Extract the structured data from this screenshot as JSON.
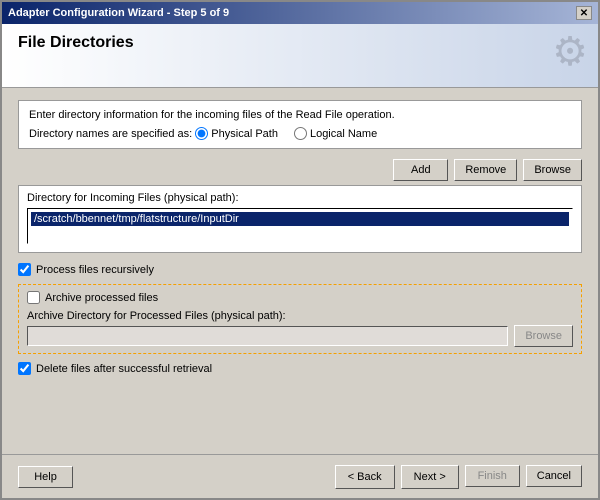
{
  "window": {
    "title": "Adapter Configuration Wizard - Step 5 of 9",
    "close_button": "✕"
  },
  "header": {
    "title": "File Directories",
    "gear_icon": "⚙"
  },
  "info": {
    "line1": "Enter directory information for the incoming files of the Read File operation.",
    "line2": "Directory names are specified as:"
  },
  "radio_group": {
    "options": [
      {
        "label": "Physical Path",
        "value": "physical",
        "selected": true
      },
      {
        "label": "Logical Name",
        "value": "logical",
        "selected": false
      }
    ]
  },
  "buttons": {
    "add": "Add",
    "remove": "Remove",
    "browse": "Browse"
  },
  "directory_section": {
    "label": "Directory for Incoming Files (physical path):",
    "value": "/scratch/bbennet/tmp/flatstructure/InputDir"
  },
  "process_recursive": {
    "label": "Process files recursively",
    "checked": true
  },
  "archive": {
    "checkbox_label": "Archive processed files",
    "checked": false,
    "dir_label": "Archive Directory for Processed Files (physical path):",
    "dir_value": "",
    "browse_label": "Browse"
  },
  "delete_files": {
    "label": "Delete files after successful retrieval",
    "checked": true
  },
  "footer": {
    "help": "Help",
    "back": "< Back",
    "next": "Next >",
    "finish": "Finish",
    "cancel": "Cancel"
  }
}
